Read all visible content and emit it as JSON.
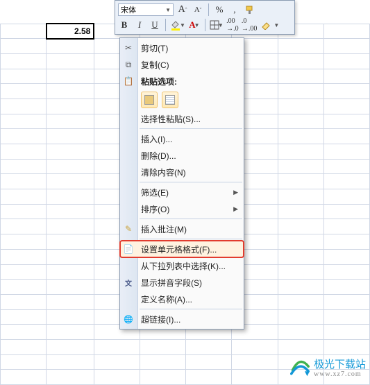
{
  "cell_value": "2.58",
  "toolbar": {
    "font_name": "宋体",
    "bold": "B",
    "italic": "I",
    "underline": "U",
    "increase_font": "A",
    "decrease_font": "A"
  },
  "menu": {
    "cut": "剪切(T)",
    "copy": "复制(C)",
    "paste_options_header": "粘贴选项:",
    "paste_special": "选择性粘贴(S)...",
    "insert": "插入(I)...",
    "delete": "删除(D)...",
    "clear_contents": "清除内容(N)",
    "filter": "筛选(E)",
    "sort": "排序(O)",
    "insert_comment": "插入批注(M)",
    "format_cells": "设置单元格格式(F)...",
    "pick_from_list": "从下拉列表中选择(K)...",
    "show_pinyin": "显示拼音字段(S)",
    "define_name": "定义名称(A)...",
    "hyperlink": "超链接(I)..."
  },
  "watermark": {
    "title": "极光下载站",
    "url": "www.xz7.com"
  }
}
